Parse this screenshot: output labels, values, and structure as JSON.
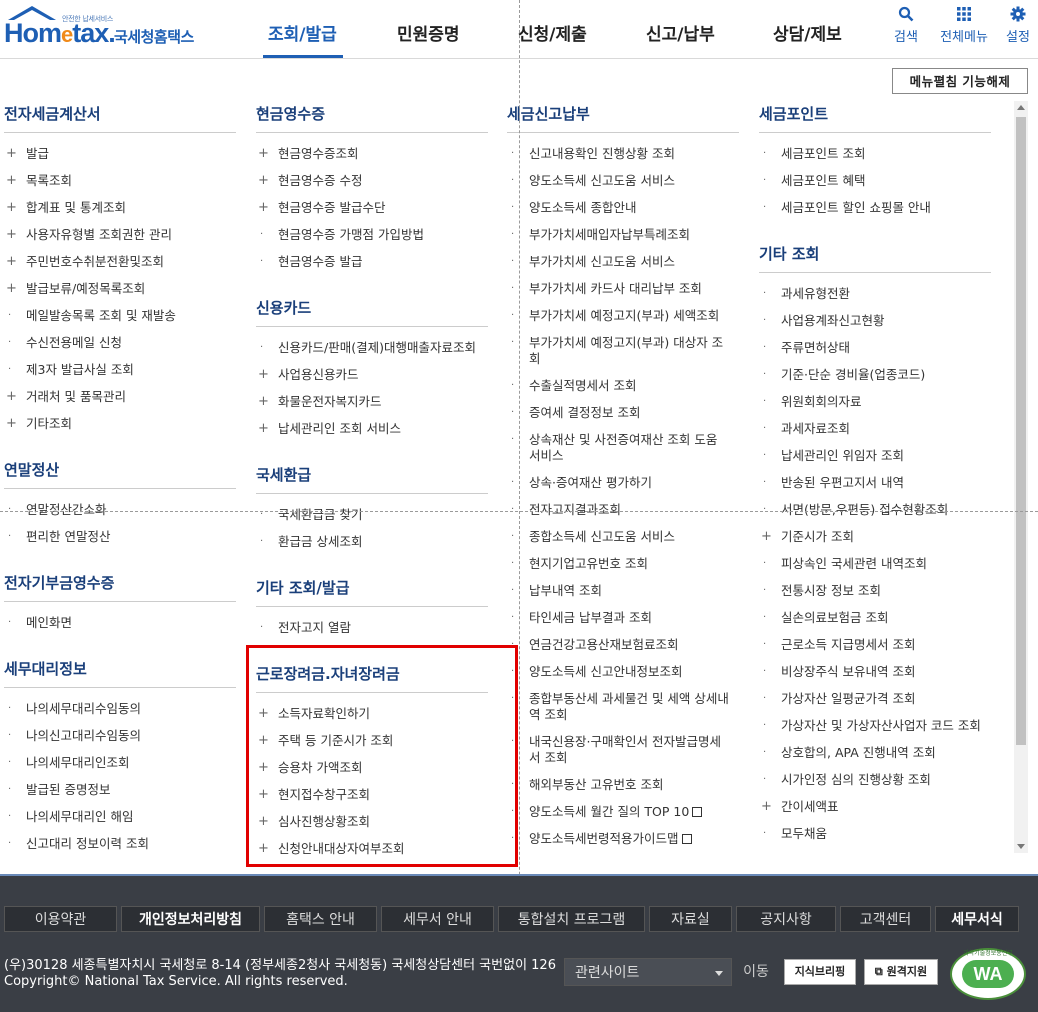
{
  "header": {
    "logo_small": "안전한 납세서비스",
    "logo_main": "Hom",
    "logo_e": "e",
    "logo_tax": "tax.",
    "logo_kr": "국세청홈택스",
    "gnb": [
      "조회/발급",
      "민원증명",
      "신청/제출",
      "신고/납부",
      "상담/제보"
    ],
    "util": [
      {
        "label": "검색",
        "icon": "search-icon"
      },
      {
        "label": "전체메뉴",
        "icon": "grid-icon"
      },
      {
        "label": "설정",
        "icon": "gear-icon"
      }
    ]
  },
  "toggle_button": "메뉴펼침 기능해제",
  "columns": [
    [
      {
        "title": "전자세금계산서",
        "items": [
          {
            "t": "발급",
            "m": "+"
          },
          {
            "t": "목록조회",
            "m": "+"
          },
          {
            "t": "합계표 및 통계조회",
            "m": "+"
          },
          {
            "t": "사용자유형별 조회권한 관리",
            "m": "+"
          },
          {
            "t": "주민번호수취분전환및조회",
            "m": "+"
          },
          {
            "t": "발급보류/예정목록조회",
            "m": "+"
          },
          {
            "t": "메일발송목록 조회 및 재발송",
            "m": "·"
          },
          {
            "t": "수신전용메일 신청",
            "m": "·"
          },
          {
            "t": "제3자 발급사실 조회",
            "m": "·"
          },
          {
            "t": "거래처 및 품목관리",
            "m": "+"
          },
          {
            "t": "기타조회",
            "m": "+"
          }
        ]
      },
      {
        "title": "연말정산",
        "items": [
          {
            "t": "연말정산간소화",
            "m": "·"
          },
          {
            "t": "편리한 연말정산",
            "m": "·"
          }
        ]
      },
      {
        "title": "전자기부금영수증",
        "items": [
          {
            "t": "메인화면",
            "m": "·"
          }
        ]
      },
      {
        "title": "세무대리정보",
        "items": [
          {
            "t": "나의세무대리수임동의",
            "m": "·"
          },
          {
            "t": "나의신고대리수임동의",
            "m": "·"
          },
          {
            "t": "나의세무대리인조회",
            "m": "·"
          },
          {
            "t": "발급된 증명정보",
            "m": "·"
          },
          {
            "t": "나의세무대리인 해임",
            "m": "·"
          },
          {
            "t": "신고대리 정보이력 조회",
            "m": "·"
          }
        ]
      }
    ],
    [
      {
        "title": "현금영수증",
        "items": [
          {
            "t": "현금영수증조회",
            "m": "+"
          },
          {
            "t": "현금영수증 수정",
            "m": "+"
          },
          {
            "t": "현금영수증 발급수단",
            "m": "+"
          },
          {
            "t": "현금영수증 가맹점 가입방법",
            "m": "·"
          },
          {
            "t": "현금영수증 발급",
            "m": "·"
          }
        ]
      },
      {
        "title": "신용카드",
        "items": [
          {
            "t": "신용카드/판매(결제)대행매출자료조회",
            "m": "·"
          },
          {
            "t": "사업용신용카드",
            "m": "+"
          },
          {
            "t": "화물운전자복지카드",
            "m": "+"
          },
          {
            "t": "납세관리인 조회 서비스",
            "m": "+"
          }
        ]
      },
      {
        "title": "국세환급",
        "items": [
          {
            "t": "국세환급금 찾기",
            "m": "·"
          },
          {
            "t": "환급금 상세조회",
            "m": "·"
          }
        ]
      },
      {
        "title": "기타 조회/발급",
        "items": [
          {
            "t": "전자고지 열람",
            "m": "·"
          }
        ]
      },
      {
        "title": "근로장려금.자녀장려금",
        "items": [
          {
            "t": "소득자료확인하기",
            "m": "+"
          },
          {
            "t": "주택 등 기준시가 조회",
            "m": "+"
          },
          {
            "t": "승용차 가액조회",
            "m": "+"
          },
          {
            "t": "현지접수창구조회",
            "m": "+"
          },
          {
            "t": "심사진행상황조회",
            "m": "+"
          },
          {
            "t": "신청안내대상자여부조회",
            "m": "+"
          }
        ]
      }
    ],
    [
      {
        "title": "세금신고납부",
        "items": [
          {
            "t": "신고내용확인 진행상황 조회",
            "m": "·"
          },
          {
            "t": "양도소득세 신고도움 서비스",
            "m": "·"
          },
          {
            "t": "양도소득세 종합안내",
            "m": "·"
          },
          {
            "t": "부가가치세매입자납부특례조회",
            "m": "·"
          },
          {
            "t": "부가가치세 신고도움 서비스",
            "m": "·"
          },
          {
            "t": "부가가치세 카드사 대리납부 조회",
            "m": "·"
          },
          {
            "t": "부가가치세 예정고지(부과) 세액조회",
            "m": "·"
          },
          {
            "t": "부가가치세 예정고지(부과) 대상자 조회",
            "m": "·"
          },
          {
            "t": "수출실적명세서 조회",
            "m": "·"
          },
          {
            "t": "증여세 결정정보 조회",
            "m": "·"
          },
          {
            "t": "상속재산 및 사전증여재산 조회 도움 서비스",
            "m": "·"
          },
          {
            "t": "상속·증여재산 평가하기",
            "m": "·"
          },
          {
            "t": "전자고지결과조회",
            "m": "·"
          },
          {
            "t": "종합소득세 신고도움 서비스",
            "m": "·"
          },
          {
            "t": "현지기업고유번호 조회",
            "m": "·"
          },
          {
            "t": "납부내역 조회",
            "m": "·"
          },
          {
            "t": "타인세금 납부결과 조회",
            "m": "·"
          },
          {
            "t": "연금건강고용산재보험료조회",
            "m": "·"
          },
          {
            "t": "양도소득세 신고안내정보조회",
            "m": "·"
          },
          {
            "t": "종합부동산세 과세물건 및 세액 상세내역 조회",
            "m": "·"
          },
          {
            "t": "내국신용장·구매확인서 전자발급명세서 조회",
            "m": "·"
          },
          {
            "t": "해외부동산 고유번호 조회",
            "m": "·"
          },
          {
            "t": "양도소득세 월간 질의 TOP 10",
            "m": "·",
            "ext": true
          },
          {
            "t": "양도소득세번령적용가이드맵",
            "m": "·",
            "ext": true
          }
        ]
      }
    ],
    [
      {
        "title": "세금포인트",
        "items": [
          {
            "t": "세금포인트 조회",
            "m": "·"
          },
          {
            "t": "세금포인트 혜택",
            "m": "·"
          },
          {
            "t": "세금포인트 할인 쇼핑몰 안내",
            "m": "·"
          }
        ]
      },
      {
        "title": "기타 조회",
        "items": [
          {
            "t": "과세유형전환",
            "m": "·"
          },
          {
            "t": "사업용계좌신고현황",
            "m": "·"
          },
          {
            "t": "주류면허상태",
            "m": "·"
          },
          {
            "t": "기준·단순 경비율(업종코드)",
            "m": "·"
          },
          {
            "t": "위원회회의자료",
            "m": "·"
          },
          {
            "t": "과세자료조회",
            "m": "·"
          },
          {
            "t": "납세관리인 위임자 조회",
            "m": "·"
          },
          {
            "t": "반송된 우편고지서 내역",
            "m": "·"
          },
          {
            "t": "서면(방문,우편등) 접수현황조회",
            "m": "·"
          },
          {
            "t": "기준시가 조회",
            "m": "+"
          },
          {
            "t": "피상속인 국세관련 내역조회",
            "m": "·"
          },
          {
            "t": "전통시장 정보 조회",
            "m": "·"
          },
          {
            "t": "실손의료보험금 조회",
            "m": "·"
          },
          {
            "t": "근로소득 지급명세서 조회",
            "m": "·"
          },
          {
            "t": "비상장주식 보유내역 조회",
            "m": "·"
          },
          {
            "t": "가상자산 일평균가격 조회",
            "m": "·"
          },
          {
            "t": "가상자산 및 가상자산사업자 코드 조회",
            "m": "·"
          },
          {
            "t": "상호합의, APA 진행내역 조회",
            "m": "·"
          },
          {
            "t": "시가인정 심의 진행상황 조회",
            "m": "·"
          },
          {
            "t": "간이세액표",
            "m": "+"
          },
          {
            "t": "모두채움",
            "m": "·"
          }
        ]
      }
    ]
  ],
  "footer": {
    "nav": [
      {
        "label": "이용약관",
        "bold": false
      },
      {
        "label": "개인정보처리방침",
        "bold": true
      },
      {
        "label": "홈택스 안내",
        "bold": false
      },
      {
        "label": "세무서 안내",
        "bold": false
      },
      {
        "label": "통합설치 프로그램",
        "bold": false
      },
      {
        "label": "자료실",
        "bold": false
      },
      {
        "label": "공지사항",
        "bold": false
      },
      {
        "label": "고객센터",
        "bold": false
      },
      {
        "label": "세무서식",
        "bold": true
      }
    ],
    "address": "(우)30128 세종특별자치시 국세청로 8-14 (정부세종2청사 국세청동) 국세청상담센터 국번없이 126",
    "copyright": "Copyright© National Tax Service. All rights reserved.",
    "related_site": "관련사이트",
    "move": "이동",
    "btn_briefing": "지식브리핑",
    "btn_remote": "원격지원",
    "wa_mark": "WA",
    "wa_arc": "과학기술정보통신부"
  }
}
